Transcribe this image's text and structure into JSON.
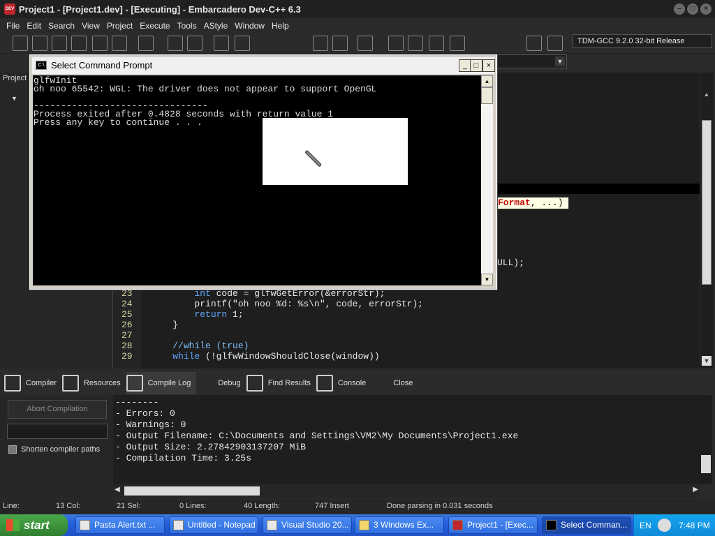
{
  "window": {
    "title": "Project1 - [Project1.dev] - [Executing] - Embarcadero Dev-C++ 6.3"
  },
  "menu": [
    "File",
    "Edit",
    "Search",
    "View",
    "Project",
    "Execute",
    "Tools",
    "AStyle",
    "Window",
    "Help"
  ],
  "toolbar": {
    "compiler": "TDM-GCC 9.2.0 32-bit Release"
  },
  "project_panel": {
    "tab_label": "Project"
  },
  "editor": {
    "tooltip_highlight": "Format",
    "tooltip_rest": ", ...)",
    "fragment": "ULL);",
    "lines": [
      {
        "num": "23",
        "indent": "        ",
        "kw": "int",
        "text": " code = glfwGetError(&errorStr);"
      },
      {
        "num": "24",
        "indent": "        ",
        "kw": "",
        "text": "printf(\"oh noo %d: %s\\n\", code, errorStr);"
      },
      {
        "num": "25",
        "indent": "        ",
        "kw": "return",
        "text": " 1;"
      },
      {
        "num": "26",
        "indent": "    ",
        "kw": "",
        "text": "}"
      },
      {
        "num": "27",
        "indent": "",
        "kw": "",
        "text": ""
      },
      {
        "num": "28",
        "indent": "    ",
        "kw": "",
        "text": "//while (true)"
      },
      {
        "num": "29",
        "indent": "    ",
        "kw": "while",
        "text": " (!glfwWindowShouldClose(window))"
      }
    ]
  },
  "bottom_tabs": [
    "Compiler",
    "Resources",
    "Compile Log",
    "Debug",
    "Find Results",
    "Console",
    "Close"
  ],
  "compile_panel": {
    "abort_label": "Abort Compilation",
    "shorten_label": "Shorten compiler paths",
    "log": [
      "--------",
      "- Errors: 0",
      "- Warnings: 0",
      "- Output Filename: C:\\Documents and Settings\\VM2\\My Documents\\Project1.exe",
      "- Output Size: 2.27842903137207 MiB",
      "- Compilation Time: 3.25s"
    ]
  },
  "statusbar": {
    "line_label": "Line:",
    "col": "13 Col:",
    "sel": "21 Sel:",
    "lines": "0 Lines:",
    "length": "40 Length:",
    "insert": "747 Insert",
    "parse": "Done parsing in 0.031 seconds"
  },
  "console": {
    "title": "Select Command Prompt",
    "lines": [
      "glfwInit",
      "oh noo 65542: WGL: The driver does not appear to support OpenGL",
      "",
      "--------------------------------",
      "Process exited after 0.4828 seconds with return value 1",
      "Press any key to continue . . ."
    ]
  },
  "taskbar": {
    "start_label": "start",
    "tasks": [
      "Pasta Alert.txt ...",
      "Untitled - Notepad",
      "Visual Studio 20...",
      "3 Windows Ex...",
      "Project1 - [Exec...",
      "Select Comman..."
    ],
    "lang": "EN",
    "clock": "7:48 PM"
  }
}
